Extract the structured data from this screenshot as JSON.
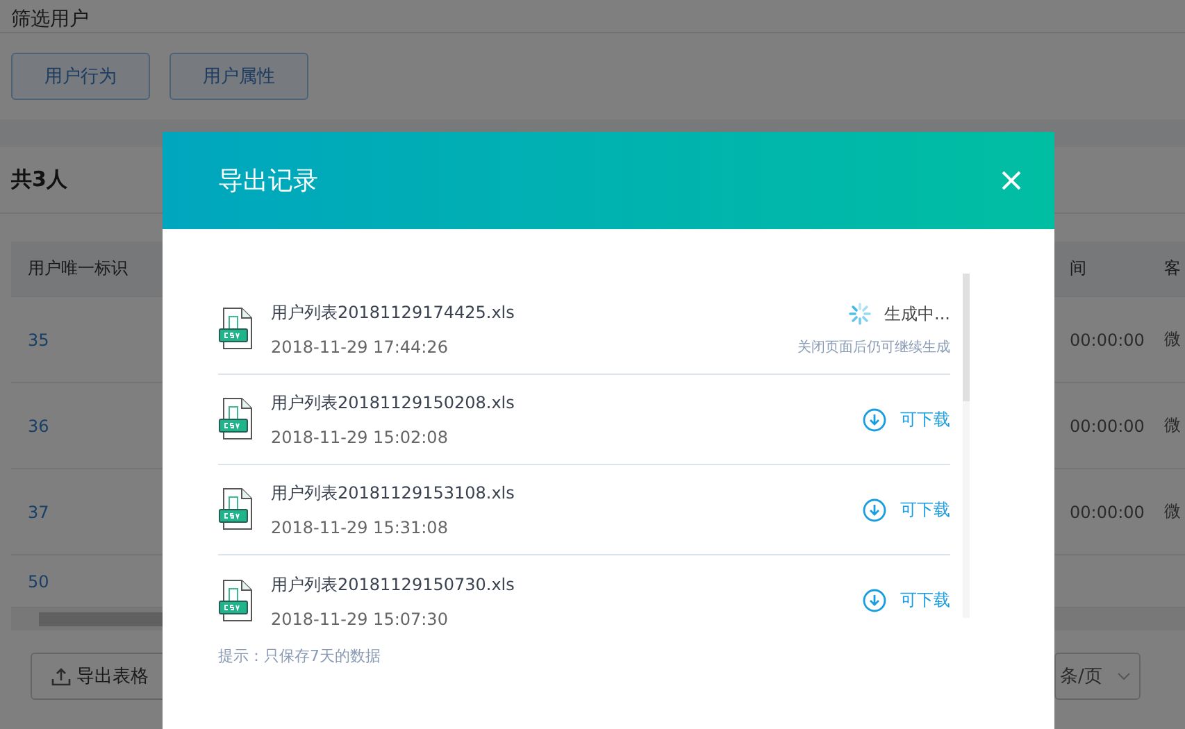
{
  "page": {
    "section_title": "筛选用户",
    "filter_buttons": [
      "用户行为",
      "用户属性"
    ],
    "total": "共3人",
    "table": {
      "columns": [
        "用户唯一标识",
        "间",
        "客"
      ],
      "rows": [
        {
          "id": "35",
          "time": "00:00:00",
          "client": "微"
        },
        {
          "id": "36",
          "time": "00:00:00",
          "client": "微"
        },
        {
          "id": "37",
          "time": "00:00:00",
          "client": "微"
        },
        {
          "id": "50",
          "time": "",
          "client": ""
        }
      ]
    },
    "export_button": "导出表格",
    "page_size": "条/页"
  },
  "dialog": {
    "title": "导出记录",
    "hint": "提示：只保存7天的数据",
    "records": [
      {
        "file": "用户列表20181129174425.xls",
        "time": "2018-11-29 17:44:26",
        "kind": "generating",
        "status": "生成中...",
        "note": "关闭页面后仍可继续生成"
      },
      {
        "file": "用户列表20181129150208.xls",
        "time": "2018-11-29 15:02:08",
        "kind": "download",
        "status": "可下载"
      },
      {
        "file": "用户列表20181129153108.xls",
        "time": "2018-11-29 15:31:08",
        "kind": "download",
        "status": "可下载"
      },
      {
        "file": "用户列表20181129150730.xls",
        "time": "2018-11-29 15:07:30",
        "kind": "download",
        "status": "可下载"
      }
    ]
  }
}
